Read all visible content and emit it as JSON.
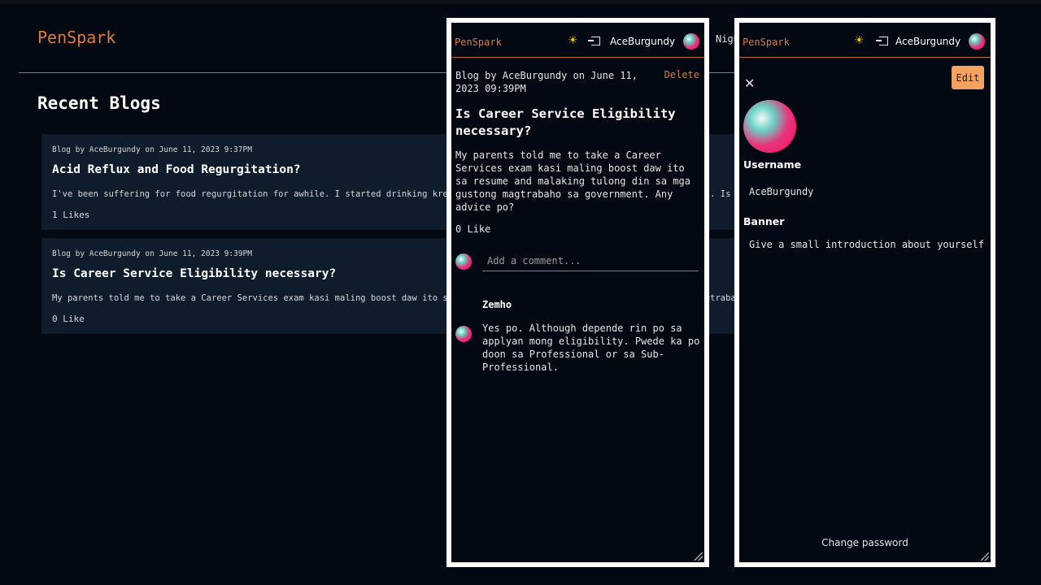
{
  "background": {
    "logo": "PenSpark",
    "theme_toggle": "Nigh",
    "heading": "Recent Blogs",
    "blogs": [
      {
        "meta": "Blog by AceBurgundy on June 11, 2023 9:37PM",
        "title": "Acid Reflux and Food Regurgitation?",
        "excerpt": "I've been suffering for food regurgitation for awhile. I started drinking kremil-s but I have never seen any significant changes. Is there any s",
        "likes": "1 Likes"
      },
      {
        "meta": "Blog by AceBurgundy on June 11, 2023 9:39PM",
        "title": "Is Career Service Eligibility necessary?",
        "excerpt": "My parents told me to take a Career Services exam kasi maling boost daw ito sa resume and malaking tulong din sa mga gustong magtrabaho",
        "likes": "0 Like"
      }
    ]
  },
  "phone1": {
    "logo": "PenSpark",
    "username": "AceBurgundy",
    "meta": "Blog by AceBurgundy on June 11, 2023 09:39PM",
    "delete_label": "Delete",
    "title": "Is Career Service Eligibility necessary?",
    "body": "My parents told me to take a Career Services exam kasi maling boost daw ito sa resume and malaking tulong din sa mga gustong magtrabaho sa government. Any advice po?",
    "likes": "0 Like",
    "comment_placeholder": "Add a comment...",
    "comments": [
      {
        "author": "Zemho",
        "text": "Yes po. Although depende rin po sa applyan mong eligibility. Pwede ka po doon sa Professional or sa Sub-Professional."
      }
    ]
  },
  "phone2": {
    "logo": "PenSpark",
    "username": "AceBurgundy",
    "close_label": "✕",
    "edit_label": "Edit",
    "username_label": "Username",
    "username_value": "AceBurgundy",
    "banner_label": "Banner",
    "banner_value": "Give a small introduction about yourself",
    "change_password": "Change password"
  },
  "icons": {
    "theme": "sun-icon",
    "login": "login-icon",
    "close": "close-icon"
  },
  "colors": {
    "background": "#020912",
    "accent": "#e07a3a",
    "card": "#0e1c2c",
    "edit_button": "#f4a261"
  }
}
